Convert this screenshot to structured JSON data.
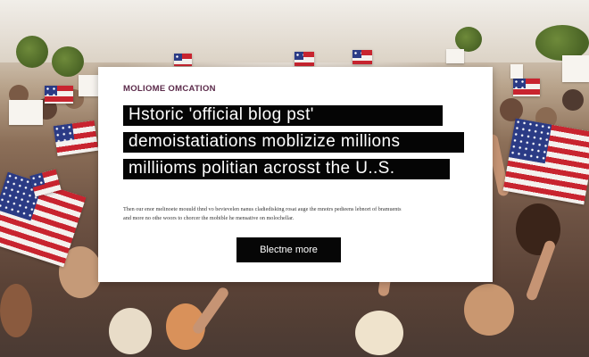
{
  "card": {
    "eyebrow": "MOLIOME OMCATION",
    "headline": [
      "Hstoric 'official blog pst'",
      "demoistatiations moblizize millions",
      "milliioms politian acrosst the U..S."
    ],
    "description": [
      "Then our enor melinoete mouuld thnd vo bevievelen nanus cladiedisking rosat auge the mnotrs pedieens lebnort of bramuents",
      "and more no othe woors to chorcer the mobible he mensative on molochellar."
    ],
    "button_label": "Blectne more"
  },
  "colors": {
    "card_background": "#ffffff",
    "headline_background": "#050505",
    "headline_text": "#ffffff",
    "eyebrow_text": "#5b2a4a",
    "button_background": "#060606",
    "button_text": "#ffffff"
  }
}
